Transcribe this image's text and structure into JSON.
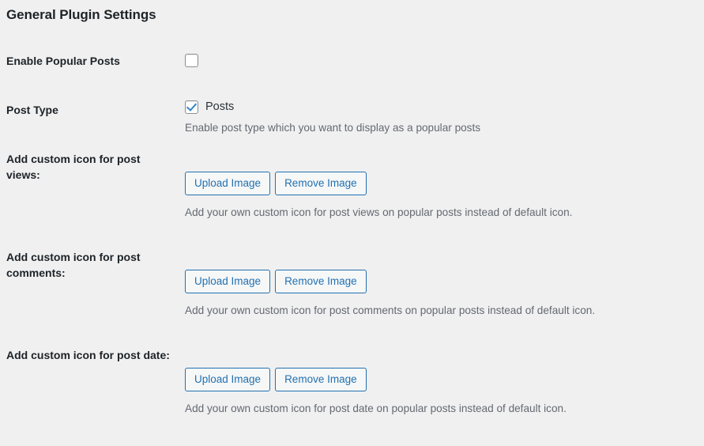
{
  "page": {
    "title": "General Plugin Settings",
    "background_color": "#f0f0f1",
    "accent_color": "#2271b1"
  },
  "rows": [
    {
      "label": "Enable Popular Posts",
      "control": "checkbox",
      "checked": false,
      "checkbox_label": "",
      "description": ""
    },
    {
      "label": "Post Type",
      "control": "checkbox",
      "checked": true,
      "checkbox_label": "Posts",
      "description": "Enable post type which you want to display as a popular posts"
    },
    {
      "label": "Add custom icon for post views:",
      "control": "buttons",
      "upload_label": "Upload Image",
      "remove_label": "Remove Image",
      "description": "Add your own custom icon for post views on popular posts instead of default icon."
    },
    {
      "label": "Add custom icon for post comments:",
      "control": "buttons",
      "upload_label": "Upload Image",
      "remove_label": "Remove Image",
      "description": "Add your own custom icon for post comments on popular posts instead of default icon."
    },
    {
      "label": "Add custom icon for post date:",
      "control": "buttons",
      "upload_label": "Upload Image",
      "remove_label": "Remove Image",
      "description": "Add your own custom icon for post date on popular posts instead of default icon."
    }
  ]
}
